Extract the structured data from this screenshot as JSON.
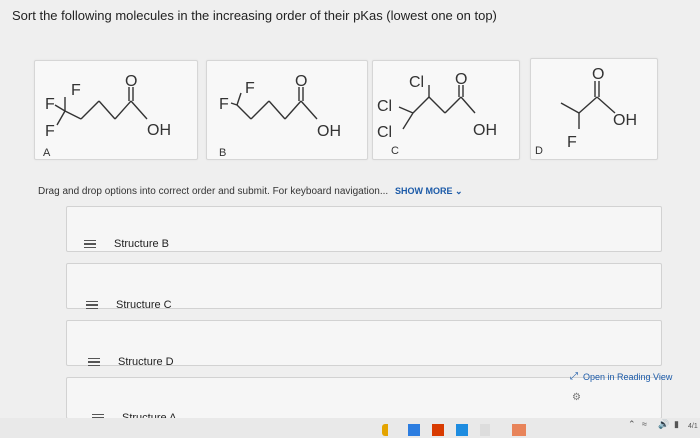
{
  "question": "Sort the following molecules in the increasing order of their pKas (lowest one on top)",
  "structures": [
    {
      "label": "A"
    },
    {
      "label": "B"
    },
    {
      "label": "C"
    },
    {
      "label": "D"
    }
  ],
  "atoms": {
    "F": "F",
    "Cl": "Cl",
    "O": "O",
    "OH": "OH"
  },
  "instructions": "Drag and drop options into correct order and submit. For keyboard navigation... ",
  "show_more": "SHOW MORE",
  "items": [
    {
      "label": "Structure B"
    },
    {
      "label": "Structure C"
    },
    {
      "label": "Structure D"
    },
    {
      "label": "Structure A"
    }
  ],
  "reading_view": "Open in Reading View",
  "tray_date": "4/1",
  "colors": {
    "link": "#1b5aa8",
    "card": "#f8f8f8",
    "border": "#d6d6d6"
  }
}
